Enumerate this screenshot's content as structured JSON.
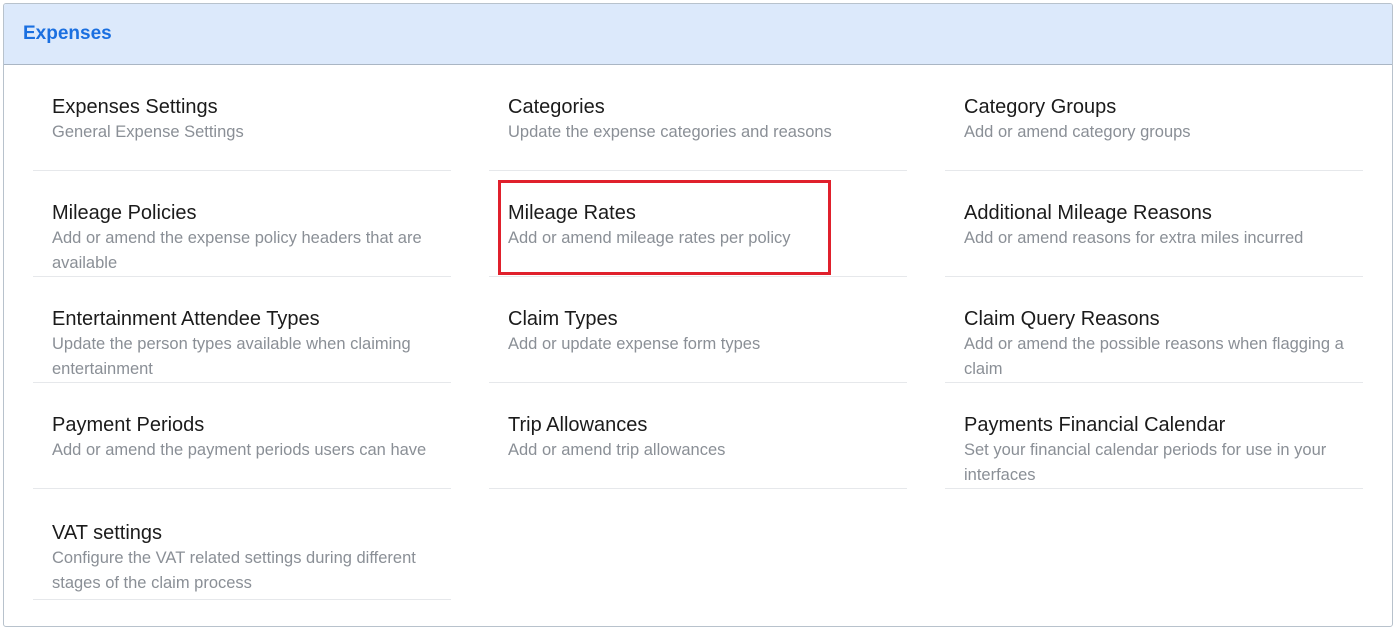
{
  "header": {
    "title": "Expenses"
  },
  "items": [
    {
      "title": "Expenses Settings",
      "description": "General Expense Settings"
    },
    {
      "title": "Categories",
      "description": "Update the expense categories and reasons"
    },
    {
      "title": "Category Groups",
      "description": "Add or amend category groups"
    },
    {
      "title": "Mileage Policies",
      "description": "Add or amend the expense policy headers that are available"
    },
    {
      "title": "Mileage Rates",
      "description": "Add or amend mileage rates per policy"
    },
    {
      "title": "Additional Mileage Reasons",
      "description": "Add or amend reasons for extra miles incurred"
    },
    {
      "title": "Entertainment Attendee Types",
      "description": "Update the person types available when claiming entertainment"
    },
    {
      "title": "Claim Types",
      "description": "Add or update expense form types"
    },
    {
      "title": "Claim Query Reasons",
      "description": "Add or amend the possible reasons when flagging a claim"
    },
    {
      "title": "Payment Periods",
      "description": "Add or amend the payment periods users can have"
    },
    {
      "title": "Trip Allowances",
      "description": "Add or amend trip allowances"
    },
    {
      "title": "Payments Financial Calendar",
      "description": "Set your financial calendar periods for use in your interfaces"
    },
    {
      "title": "VAT settings",
      "description": "Configure the VAT related settings during different stages of the claim process"
    }
  ],
  "highlight_color": "#e0202c"
}
